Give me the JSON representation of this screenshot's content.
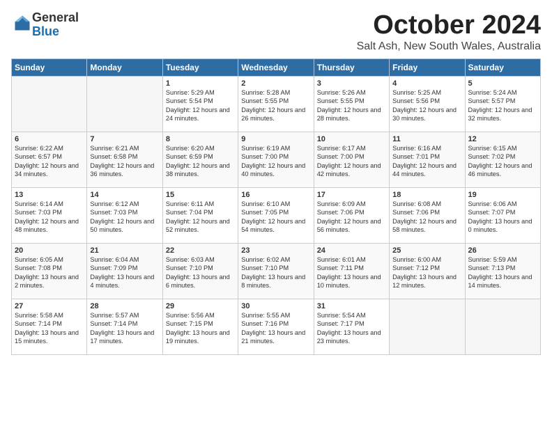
{
  "logo": {
    "general": "General",
    "blue": "Blue"
  },
  "title": "October 2024",
  "location": "Salt Ash, New South Wales, Australia",
  "days_of_week": [
    "Sunday",
    "Monday",
    "Tuesday",
    "Wednesday",
    "Thursday",
    "Friday",
    "Saturday"
  ],
  "weeks": [
    [
      {
        "day": "",
        "empty": true
      },
      {
        "day": "",
        "empty": true
      },
      {
        "day": "1",
        "sunrise": "Sunrise: 5:29 AM",
        "sunset": "Sunset: 5:54 PM",
        "daylight": "Daylight: 12 hours and 24 minutes."
      },
      {
        "day": "2",
        "sunrise": "Sunrise: 5:28 AM",
        "sunset": "Sunset: 5:55 PM",
        "daylight": "Daylight: 12 hours and 26 minutes."
      },
      {
        "day": "3",
        "sunrise": "Sunrise: 5:26 AM",
        "sunset": "Sunset: 5:55 PM",
        "daylight": "Daylight: 12 hours and 28 minutes."
      },
      {
        "day": "4",
        "sunrise": "Sunrise: 5:25 AM",
        "sunset": "Sunset: 5:56 PM",
        "daylight": "Daylight: 12 hours and 30 minutes."
      },
      {
        "day": "5",
        "sunrise": "Sunrise: 5:24 AM",
        "sunset": "Sunset: 5:57 PM",
        "daylight": "Daylight: 12 hours and 32 minutes."
      }
    ],
    [
      {
        "day": "6",
        "sunrise": "Sunrise: 6:22 AM",
        "sunset": "Sunset: 6:57 PM",
        "daylight": "Daylight: 12 hours and 34 minutes."
      },
      {
        "day": "7",
        "sunrise": "Sunrise: 6:21 AM",
        "sunset": "Sunset: 6:58 PM",
        "daylight": "Daylight: 12 hours and 36 minutes."
      },
      {
        "day": "8",
        "sunrise": "Sunrise: 6:20 AM",
        "sunset": "Sunset: 6:59 PM",
        "daylight": "Daylight: 12 hours and 38 minutes."
      },
      {
        "day": "9",
        "sunrise": "Sunrise: 6:19 AM",
        "sunset": "Sunset: 7:00 PM",
        "daylight": "Daylight: 12 hours and 40 minutes."
      },
      {
        "day": "10",
        "sunrise": "Sunrise: 6:17 AM",
        "sunset": "Sunset: 7:00 PM",
        "daylight": "Daylight: 12 hours and 42 minutes."
      },
      {
        "day": "11",
        "sunrise": "Sunrise: 6:16 AM",
        "sunset": "Sunset: 7:01 PM",
        "daylight": "Daylight: 12 hours and 44 minutes."
      },
      {
        "day": "12",
        "sunrise": "Sunrise: 6:15 AM",
        "sunset": "Sunset: 7:02 PM",
        "daylight": "Daylight: 12 hours and 46 minutes."
      }
    ],
    [
      {
        "day": "13",
        "sunrise": "Sunrise: 6:14 AM",
        "sunset": "Sunset: 7:03 PM",
        "daylight": "Daylight: 12 hours and 48 minutes."
      },
      {
        "day": "14",
        "sunrise": "Sunrise: 6:12 AM",
        "sunset": "Sunset: 7:03 PM",
        "daylight": "Daylight: 12 hours and 50 minutes."
      },
      {
        "day": "15",
        "sunrise": "Sunrise: 6:11 AM",
        "sunset": "Sunset: 7:04 PM",
        "daylight": "Daylight: 12 hours and 52 minutes."
      },
      {
        "day": "16",
        "sunrise": "Sunrise: 6:10 AM",
        "sunset": "Sunset: 7:05 PM",
        "daylight": "Daylight: 12 hours and 54 minutes."
      },
      {
        "day": "17",
        "sunrise": "Sunrise: 6:09 AM",
        "sunset": "Sunset: 7:06 PM",
        "daylight": "Daylight: 12 hours and 56 minutes."
      },
      {
        "day": "18",
        "sunrise": "Sunrise: 6:08 AM",
        "sunset": "Sunset: 7:06 PM",
        "daylight": "Daylight: 12 hours and 58 minutes."
      },
      {
        "day": "19",
        "sunrise": "Sunrise: 6:06 AM",
        "sunset": "Sunset: 7:07 PM",
        "daylight": "Daylight: 13 hours and 0 minutes."
      }
    ],
    [
      {
        "day": "20",
        "sunrise": "Sunrise: 6:05 AM",
        "sunset": "Sunset: 7:08 PM",
        "daylight": "Daylight: 13 hours and 2 minutes."
      },
      {
        "day": "21",
        "sunrise": "Sunrise: 6:04 AM",
        "sunset": "Sunset: 7:09 PM",
        "daylight": "Daylight: 13 hours and 4 minutes."
      },
      {
        "day": "22",
        "sunrise": "Sunrise: 6:03 AM",
        "sunset": "Sunset: 7:10 PM",
        "daylight": "Daylight: 13 hours and 6 minutes."
      },
      {
        "day": "23",
        "sunrise": "Sunrise: 6:02 AM",
        "sunset": "Sunset: 7:10 PM",
        "daylight": "Daylight: 13 hours and 8 minutes."
      },
      {
        "day": "24",
        "sunrise": "Sunrise: 6:01 AM",
        "sunset": "Sunset: 7:11 PM",
        "daylight": "Daylight: 13 hours and 10 minutes."
      },
      {
        "day": "25",
        "sunrise": "Sunrise: 6:00 AM",
        "sunset": "Sunset: 7:12 PM",
        "daylight": "Daylight: 13 hours and 12 minutes."
      },
      {
        "day": "26",
        "sunrise": "Sunrise: 5:59 AM",
        "sunset": "Sunset: 7:13 PM",
        "daylight": "Daylight: 13 hours and 14 minutes."
      }
    ],
    [
      {
        "day": "27",
        "sunrise": "Sunrise: 5:58 AM",
        "sunset": "Sunset: 7:14 PM",
        "daylight": "Daylight: 13 hours and 15 minutes."
      },
      {
        "day": "28",
        "sunrise": "Sunrise: 5:57 AM",
        "sunset": "Sunset: 7:14 PM",
        "daylight": "Daylight: 13 hours and 17 minutes."
      },
      {
        "day": "29",
        "sunrise": "Sunrise: 5:56 AM",
        "sunset": "Sunset: 7:15 PM",
        "daylight": "Daylight: 13 hours and 19 minutes."
      },
      {
        "day": "30",
        "sunrise": "Sunrise: 5:55 AM",
        "sunset": "Sunset: 7:16 PM",
        "daylight": "Daylight: 13 hours and 21 minutes."
      },
      {
        "day": "31",
        "sunrise": "Sunrise: 5:54 AM",
        "sunset": "Sunset: 7:17 PM",
        "daylight": "Daylight: 13 hours and 23 minutes."
      },
      {
        "day": "",
        "empty": true
      },
      {
        "day": "",
        "empty": true
      }
    ]
  ]
}
